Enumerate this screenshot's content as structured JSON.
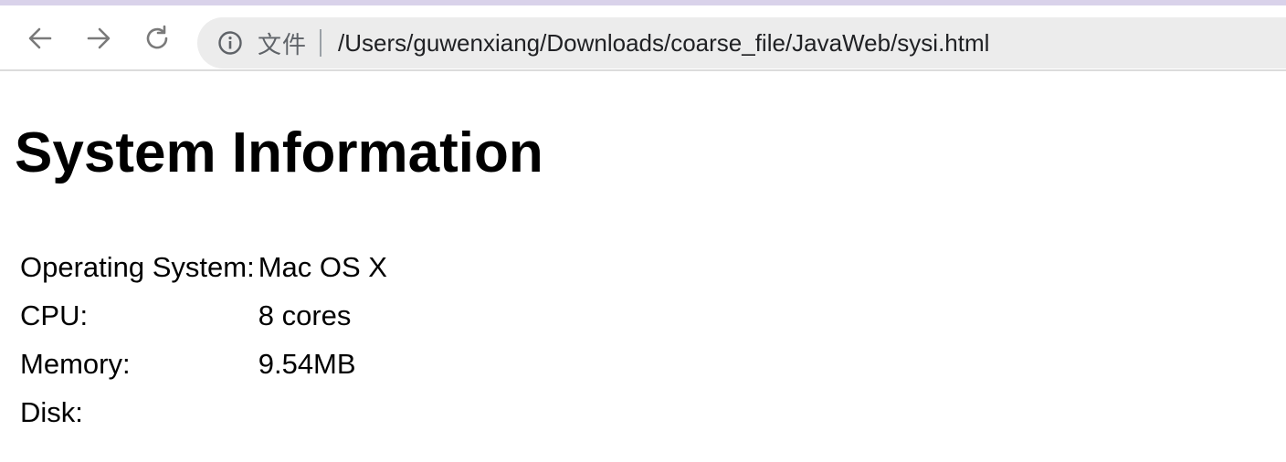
{
  "browser": {
    "scheme_label": "文件",
    "url": "/Users/guwenxiang/Downloads/coarse_file/JavaWeb/sysi.html",
    "accent_color": "#d9d2ea"
  },
  "page": {
    "title": "System Information",
    "rows": [
      {
        "label": "Operating System:",
        "value": "Mac OS X"
      },
      {
        "label": "CPU:",
        "value": "8 cores"
      },
      {
        "label": "Memory:",
        "value": "9.54MB"
      },
      {
        "label": "Disk:",
        "value": ""
      }
    ]
  }
}
